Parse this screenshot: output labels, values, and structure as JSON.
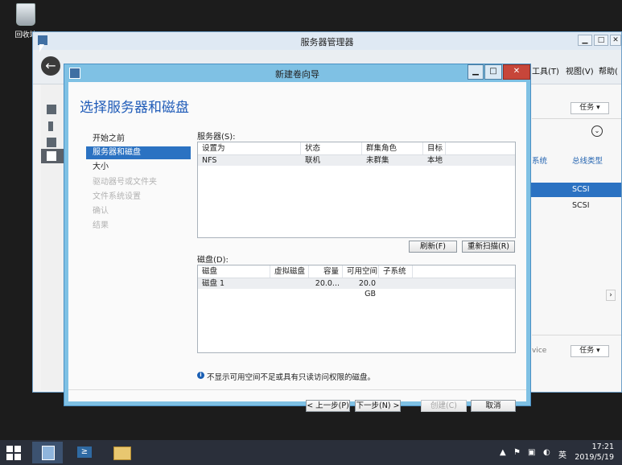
{
  "desktop": {
    "recycle_bin_label": "回收站"
  },
  "server_manager": {
    "title": "服务器管理器",
    "menus": [
      "工具(T)",
      "视图(V)",
      "帮助("
    ],
    "tasks_label": "任务",
    "col_system": "系统",
    "col_bus_type": "总线类型",
    "scsi_1": "SCSI",
    "scsi_2": "SCSI",
    "service_fragment": "vice",
    "tasks_label_2": "任务"
  },
  "wizard": {
    "title": "新建卷向导",
    "heading": "选择服务器和磁盘",
    "steps": [
      {
        "label": "开始之前",
        "state": "normal"
      },
      {
        "label": "服务器和磁盘",
        "state": "active"
      },
      {
        "label": "大小",
        "state": "normal"
      },
      {
        "label": "驱动器号或文件夹",
        "state": "disabled"
      },
      {
        "label": "文件系统设置",
        "state": "disabled"
      },
      {
        "label": "确认",
        "state": "disabled"
      },
      {
        "label": "结果",
        "state": "disabled"
      }
    ],
    "servers_label": "服务器(S):",
    "servers_columns": [
      "设置为",
      "状态",
      "群集角色",
      "目标"
    ],
    "servers_rows": [
      [
        "NFS",
        "联机",
        "未群集",
        "本地"
      ]
    ],
    "refresh_button": "刷新(F)",
    "rescan_button": "重新扫描(R)",
    "disks_label": "磁盘(D):",
    "disks_columns": [
      "磁盘",
      "虚拟磁盘",
      "容量",
      "可用空间",
      "子系统"
    ],
    "disks_rows": [
      [
        "磁盘 1",
        "",
        "20.0...",
        "20.0 GB",
        ""
      ]
    ],
    "info_text": "不显示可用空间不足或具有只读访问权限的磁盘。",
    "buttons": {
      "prev": "< 上一步(P)",
      "next": "下一步(N) >",
      "create": "创建(C)",
      "cancel": "取消"
    }
  },
  "taskbar": {
    "time": "17:21",
    "date": "2019/5/19",
    "ime": "英"
  },
  "colors": {
    "accent": "#2b72c2",
    "wizard_frame": "#7fc1e4",
    "close": "#c7463a"
  }
}
